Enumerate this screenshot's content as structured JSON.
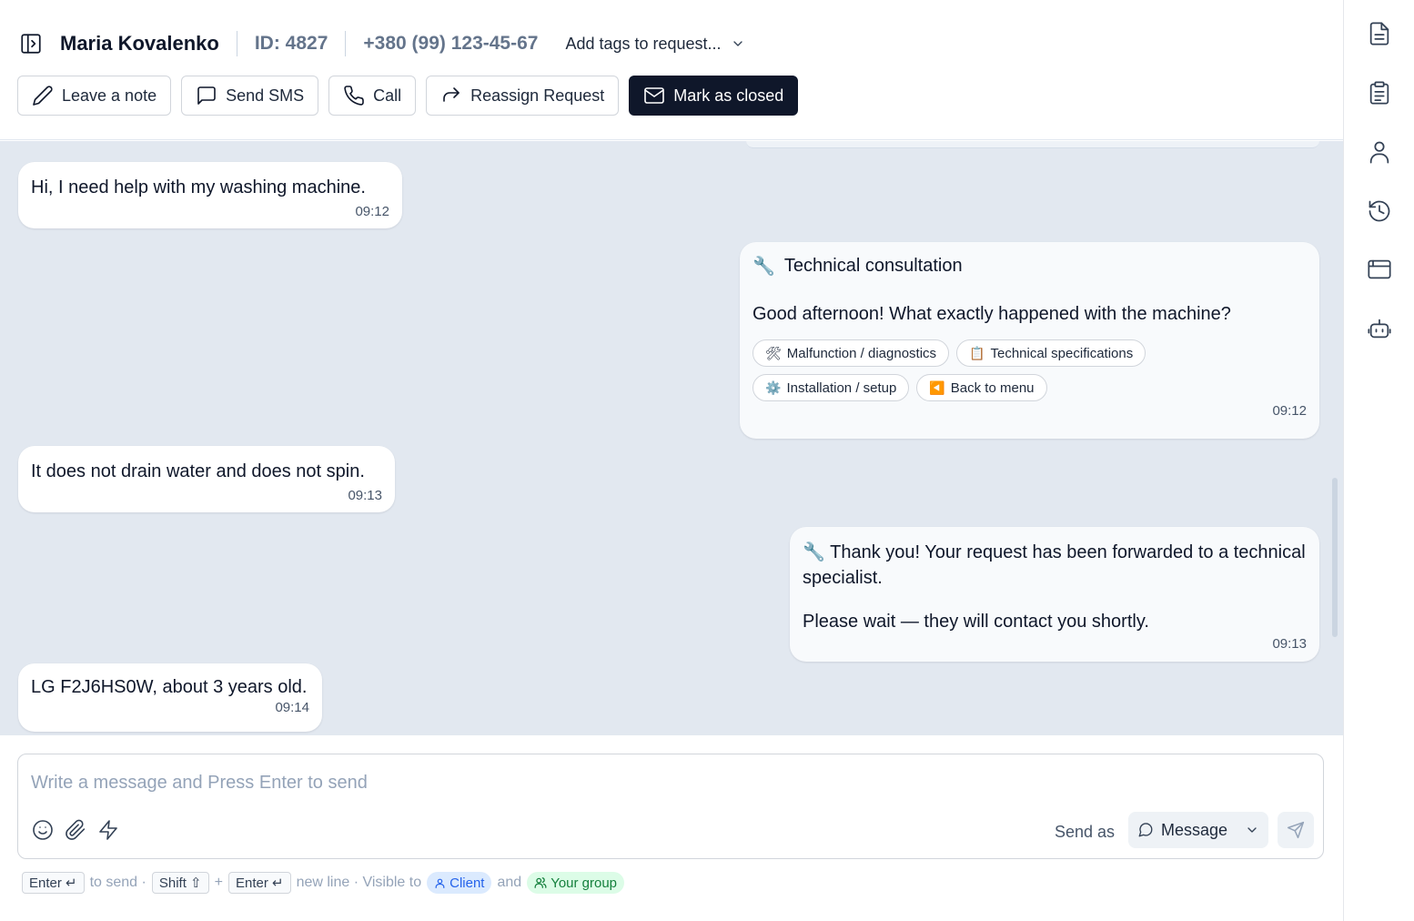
{
  "header": {
    "name": "Maria Kovalenko",
    "request_id": "ID: 4827",
    "phone": "+380 (99) 123-45-67",
    "tags_placeholder": "Add tags to request..."
  },
  "actions": {
    "leave_note": "Leave a note",
    "send_sms": "Send SMS",
    "call": "Call",
    "reassign": "Reassign Request",
    "mark_closed": "Mark as closed"
  },
  "messages": [
    {
      "direction": "incoming",
      "text": "Hi, I need help with my washing machine.",
      "time": "09:12"
    },
    {
      "direction": "outgoing",
      "title_emoji": "🔧",
      "title": "Technical consultation",
      "text": "Good afternoon! What exactly happened with the machine?",
      "options": [
        {
          "icon": "🛠",
          "label": "Malfunction / diagnostics"
        },
        {
          "icon": "📋",
          "label": "Technical specifications"
        },
        {
          "icon": "⚙️",
          "label": "Installation / setup"
        },
        {
          "icon": "◀️",
          "label": "Back to menu"
        }
      ],
      "time": "09:12"
    },
    {
      "direction": "incoming",
      "text": "It does not drain water and does not spin.",
      "time": "09:13"
    },
    {
      "direction": "outgoing",
      "emoji": "🔧",
      "text": "Thank you! Your request has been forwarded to a technical specialist.",
      "text2": "Please wait — they will contact you shortly.",
      "time": "09:13"
    },
    {
      "direction": "incoming",
      "text": "LG F2J6HS0W, about 3 years old.",
      "time": "09:14"
    }
  ],
  "composer": {
    "placeholder": "Write a message and Press Enter to send",
    "value": "",
    "send_as_label": "Send as",
    "mode": "Message"
  },
  "hint": {
    "enter_key": "Enter ↵",
    "to_send": "to send ·",
    "shift_key": "Shift ⇧",
    "plus": "+",
    "enter_key2": "Enter ↵",
    "new_line": "new line · Visible to",
    "client": "Client",
    "and": "and",
    "group": "Your group"
  },
  "icons": {
    "rail": [
      "document-icon",
      "clipboard-icon",
      "user-icon",
      "history-icon",
      "browser-window-icon",
      "bot-icon"
    ]
  },
  "colors": {
    "accent_dark": "#0f172a",
    "chat_background": "#e2e8f0",
    "client_pill": "#dbeafe",
    "group_pill": "#dcfce7"
  }
}
